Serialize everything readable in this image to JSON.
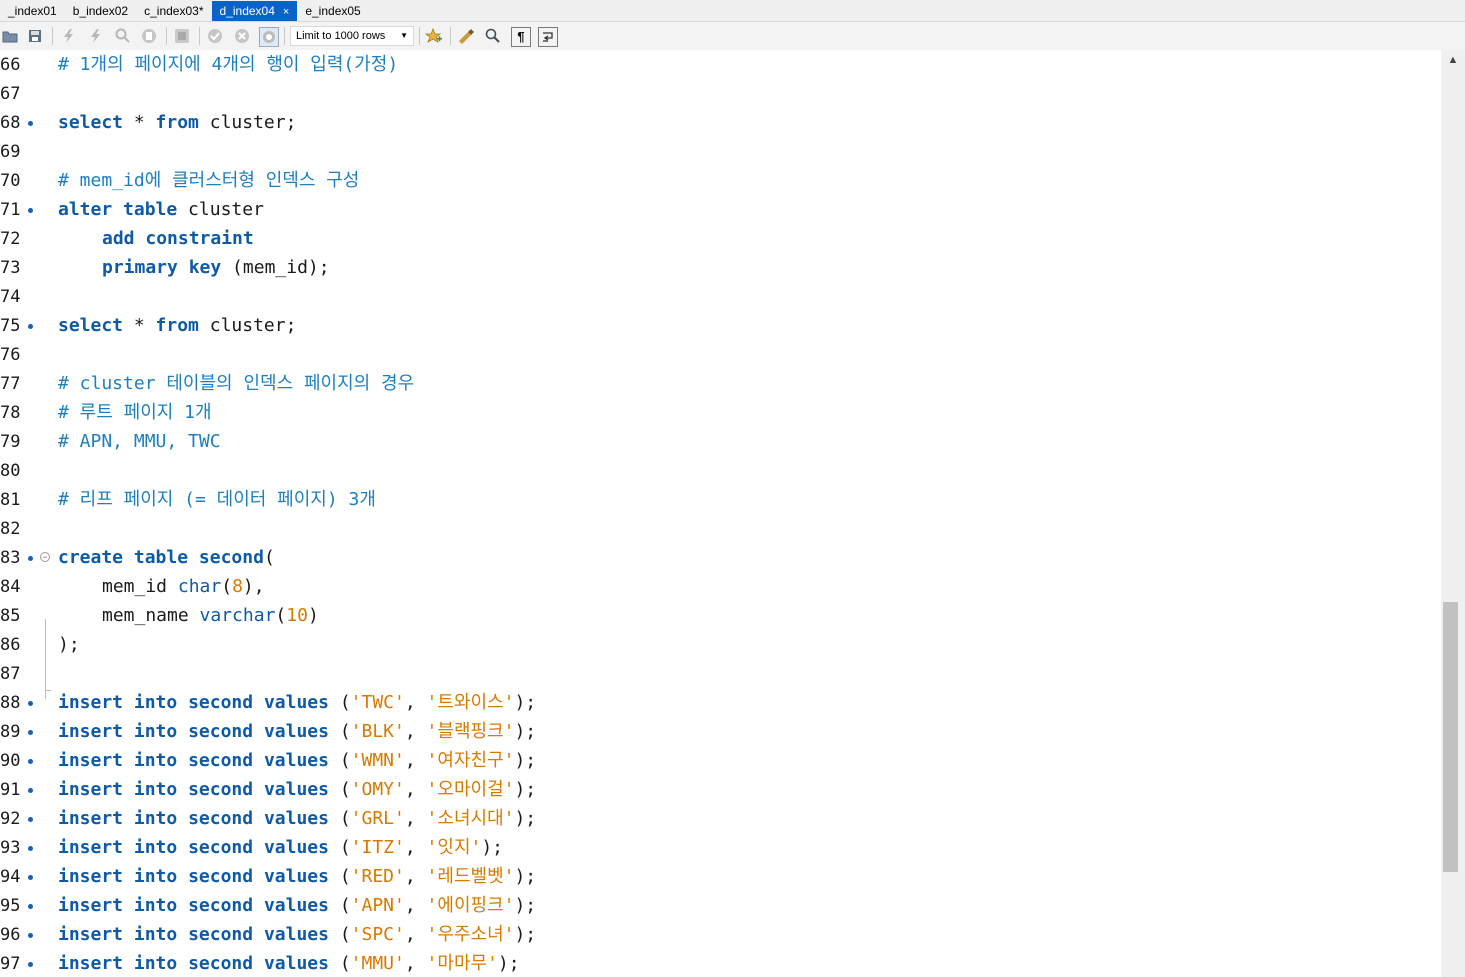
{
  "tabs": [
    {
      "label": "_index01",
      "active": false
    },
    {
      "label": "b_index02",
      "active": false
    },
    {
      "label": "c_index03*",
      "active": false
    },
    {
      "label": "d_index04",
      "active": true,
      "close": "×"
    },
    {
      "label": "e_index05",
      "active": false
    }
  ],
  "toolbar": {
    "limit_label": "Limit to 1000 rows",
    "icons": [
      "open-folder-icon",
      "save-icon",
      "execute-icon",
      "execute-current-icon",
      "explain-icon",
      "stop-icon",
      "toggle-icon",
      "commit-icon",
      "rollback-icon",
      "autocommit-icon",
      "bookmark-icon",
      "beautify-icon",
      "find-icon",
      "invisible-chars-icon",
      "wrap-icon"
    ]
  },
  "editor": {
    "lines": [
      {
        "n": "66",
        "dot": false,
        "segs": [
          [
            "cm",
            "# 1개의 페이지에 4개의 행이 입력(가정)"
          ]
        ]
      },
      {
        "n": "67",
        "dot": false,
        "segs": []
      },
      {
        "n": "68",
        "dot": true,
        "segs": [
          [
            "kw",
            "select"
          ],
          [
            "pl",
            " * "
          ],
          [
            "kw",
            "from"
          ],
          [
            "pl",
            " cluster;"
          ]
        ]
      },
      {
        "n": "69",
        "dot": false,
        "segs": []
      },
      {
        "n": "70",
        "dot": false,
        "segs": [
          [
            "cm",
            "# mem_id에 클러스터형 인덱스 구성"
          ]
        ]
      },
      {
        "n": "71",
        "dot": true,
        "segs": [
          [
            "kw",
            "alter"
          ],
          [
            "pl",
            " "
          ],
          [
            "kw",
            "table"
          ],
          [
            "pl",
            " cluster"
          ]
        ]
      },
      {
        "n": "72",
        "dot": false,
        "indent": true,
        "segs": [
          [
            "kw",
            "add"
          ],
          [
            "pl",
            " "
          ],
          [
            "kw",
            "constraint"
          ]
        ]
      },
      {
        "n": "73",
        "dot": false,
        "indent": true,
        "segs": [
          [
            "kw",
            "primary"
          ],
          [
            "pl",
            " "
          ],
          [
            "kw",
            "key"
          ],
          [
            "pl",
            " (mem_id);"
          ]
        ]
      },
      {
        "n": "74",
        "dot": false,
        "segs": []
      },
      {
        "n": "75",
        "dot": true,
        "segs": [
          [
            "kw",
            "select"
          ],
          [
            "pl",
            " * "
          ],
          [
            "kw",
            "from"
          ],
          [
            "pl",
            " cluster;"
          ]
        ]
      },
      {
        "n": "76",
        "dot": false,
        "segs": []
      },
      {
        "n": "77",
        "dot": false,
        "segs": [
          [
            "cm",
            "# cluster 테이블의 인덱스 페이지의 경우"
          ]
        ]
      },
      {
        "n": "78",
        "dot": false,
        "segs": [
          [
            "cm",
            "# 루트 페이지 1개"
          ]
        ]
      },
      {
        "n": "79",
        "dot": false,
        "segs": [
          [
            "cm",
            "# APN, MMU, TWC"
          ]
        ]
      },
      {
        "n": "80",
        "dot": false,
        "segs": []
      },
      {
        "n": "81",
        "dot": false,
        "segs": [
          [
            "cm",
            "# 리프 페이지 (= 데이터 페이지) 3개"
          ]
        ]
      },
      {
        "n": "82",
        "dot": false,
        "segs": []
      },
      {
        "n": "83",
        "dot": true,
        "fold": true,
        "segs": [
          [
            "kw",
            "create"
          ],
          [
            "pl",
            " "
          ],
          [
            "kw",
            "table"
          ],
          [
            "pl",
            " "
          ],
          [
            "kw",
            "second"
          ],
          [
            "pl",
            "("
          ]
        ]
      },
      {
        "n": "84",
        "dot": false,
        "indent": true,
        "segs": [
          [
            "pl",
            "mem_id "
          ],
          [
            "kw2",
            "char"
          ],
          [
            "pl",
            "("
          ],
          [
            "num",
            "8"
          ],
          [
            "pl",
            "),"
          ]
        ]
      },
      {
        "n": "85",
        "dot": false,
        "indent": true,
        "segs": [
          [
            "pl",
            "mem_name "
          ],
          [
            "kw2",
            "varchar"
          ],
          [
            "pl",
            "("
          ],
          [
            "num",
            "10"
          ],
          [
            "pl",
            ")"
          ]
        ]
      },
      {
        "n": "86",
        "dot": false,
        "segs": [
          [
            "pl",
            ");"
          ]
        ]
      },
      {
        "n": "87",
        "dot": false,
        "segs": []
      },
      {
        "n": "88",
        "dot": true,
        "segs": [
          [
            "kw",
            "insert"
          ],
          [
            "pl",
            " "
          ],
          [
            "kw",
            "into"
          ],
          [
            "pl",
            " "
          ],
          [
            "kw",
            "second"
          ],
          [
            "pl",
            " "
          ],
          [
            "kw",
            "values"
          ],
          [
            "pl",
            " ("
          ],
          [
            "str",
            "'TWC'"
          ],
          [
            "pl",
            ", "
          ],
          [
            "str",
            "'트와이스'"
          ],
          [
            "pl",
            ");"
          ]
        ]
      },
      {
        "n": "89",
        "dot": true,
        "segs": [
          [
            "kw",
            "insert"
          ],
          [
            "pl",
            " "
          ],
          [
            "kw",
            "into"
          ],
          [
            "pl",
            " "
          ],
          [
            "kw",
            "second"
          ],
          [
            "pl",
            " "
          ],
          [
            "kw",
            "values"
          ],
          [
            "pl",
            " ("
          ],
          [
            "str",
            "'BLK'"
          ],
          [
            "pl",
            ", "
          ],
          [
            "str",
            "'블랙핑크'"
          ],
          [
            "pl",
            ");"
          ]
        ]
      },
      {
        "n": "90",
        "dot": true,
        "segs": [
          [
            "kw",
            "insert"
          ],
          [
            "pl",
            " "
          ],
          [
            "kw",
            "into"
          ],
          [
            "pl",
            " "
          ],
          [
            "kw",
            "second"
          ],
          [
            "pl",
            " "
          ],
          [
            "kw",
            "values"
          ],
          [
            "pl",
            " ("
          ],
          [
            "str",
            "'WMN'"
          ],
          [
            "pl",
            ", "
          ],
          [
            "str",
            "'여자친구'"
          ],
          [
            "pl",
            ");"
          ]
        ]
      },
      {
        "n": "91",
        "dot": true,
        "segs": [
          [
            "kw",
            "insert"
          ],
          [
            "pl",
            " "
          ],
          [
            "kw",
            "into"
          ],
          [
            "pl",
            " "
          ],
          [
            "kw",
            "second"
          ],
          [
            "pl",
            " "
          ],
          [
            "kw",
            "values"
          ],
          [
            "pl",
            " ("
          ],
          [
            "str",
            "'OMY'"
          ],
          [
            "pl",
            ", "
          ],
          [
            "str",
            "'오마이걸'"
          ],
          [
            "pl",
            ");"
          ]
        ]
      },
      {
        "n": "92",
        "dot": true,
        "segs": [
          [
            "kw",
            "insert"
          ],
          [
            "pl",
            " "
          ],
          [
            "kw",
            "into"
          ],
          [
            "pl",
            " "
          ],
          [
            "kw",
            "second"
          ],
          [
            "pl",
            " "
          ],
          [
            "kw",
            "values"
          ],
          [
            "pl",
            " ("
          ],
          [
            "str",
            "'GRL'"
          ],
          [
            "pl",
            ", "
          ],
          [
            "str",
            "'소녀시대'"
          ],
          [
            "pl",
            ");"
          ]
        ]
      },
      {
        "n": "93",
        "dot": true,
        "segs": [
          [
            "kw",
            "insert"
          ],
          [
            "pl",
            " "
          ],
          [
            "kw",
            "into"
          ],
          [
            "pl",
            " "
          ],
          [
            "kw",
            "second"
          ],
          [
            "pl",
            " "
          ],
          [
            "kw",
            "values"
          ],
          [
            "pl",
            " ("
          ],
          [
            "str",
            "'ITZ'"
          ],
          [
            "pl",
            ", "
          ],
          [
            "str",
            "'잇지'"
          ],
          [
            "pl",
            ");"
          ]
        ]
      },
      {
        "n": "94",
        "dot": true,
        "segs": [
          [
            "kw",
            "insert"
          ],
          [
            "pl",
            " "
          ],
          [
            "kw",
            "into"
          ],
          [
            "pl",
            " "
          ],
          [
            "kw",
            "second"
          ],
          [
            "pl",
            " "
          ],
          [
            "kw",
            "values"
          ],
          [
            "pl",
            " ("
          ],
          [
            "str",
            "'RED'"
          ],
          [
            "pl",
            ", "
          ],
          [
            "str",
            "'레드벨벳'"
          ],
          [
            "pl",
            ");"
          ]
        ]
      },
      {
        "n": "95",
        "dot": true,
        "segs": [
          [
            "kw",
            "insert"
          ],
          [
            "pl",
            " "
          ],
          [
            "kw",
            "into"
          ],
          [
            "pl",
            " "
          ],
          [
            "kw",
            "second"
          ],
          [
            "pl",
            " "
          ],
          [
            "kw",
            "values"
          ],
          [
            "pl",
            " ("
          ],
          [
            "str",
            "'APN'"
          ],
          [
            "pl",
            ", "
          ],
          [
            "str",
            "'에이핑크'"
          ],
          [
            "pl",
            ");"
          ]
        ]
      },
      {
        "n": "96",
        "dot": true,
        "segs": [
          [
            "kw",
            "insert"
          ],
          [
            "pl",
            " "
          ],
          [
            "kw",
            "into"
          ],
          [
            "pl",
            " "
          ],
          [
            "kw",
            "second"
          ],
          [
            "pl",
            " "
          ],
          [
            "kw",
            "values"
          ],
          [
            "pl",
            " ("
          ],
          [
            "str",
            "'SPC'"
          ],
          [
            "pl",
            ", "
          ],
          [
            "str",
            "'우주소녀'"
          ],
          [
            "pl",
            ");"
          ]
        ]
      },
      {
        "n": "97",
        "dot": true,
        "segs": [
          [
            "kw",
            "insert"
          ],
          [
            "pl",
            " "
          ],
          [
            "kw",
            "into"
          ],
          [
            "pl",
            " "
          ],
          [
            "kw",
            "second"
          ],
          [
            "pl",
            " "
          ],
          [
            "kw",
            "values"
          ],
          [
            "pl",
            " ("
          ],
          [
            "str",
            "'MMU'"
          ],
          [
            "pl",
            ", "
          ],
          [
            "str",
            "'마마무'"
          ],
          [
            "pl",
            ");"
          ]
        ]
      }
    ]
  },
  "colors": {
    "keyword": "#0f5aa6",
    "comment": "#1e7fbf",
    "string": "#d97a00",
    "active_tab": "#0a64c8"
  }
}
